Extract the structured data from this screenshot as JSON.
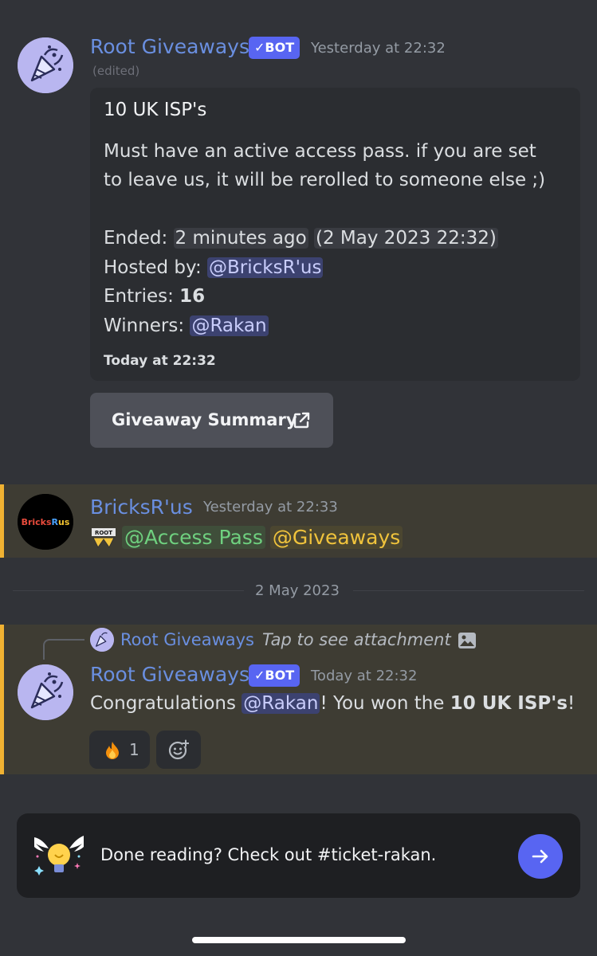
{
  "message1": {
    "author": "Root Giveaways",
    "bot_tag": "BOT",
    "timestamp": "Yesterday at 22:32",
    "edited": "(edited)",
    "embed": {
      "title": "10 UK ISP's",
      "desc_line1": "Must have an active access pass. if you are set",
      "desc_line2": "to leave us, it will be rerolled to someone else ;)",
      "ended_label": "Ended: ",
      "ended_relative": "2 minutes ago",
      "ended_absolute": "(2 May 2023 22:32)",
      "hosted_label": "Hosted by: ",
      "hosted_mention": "@BricksR'us",
      "entries_label": "Entries: ",
      "entries_value": "16",
      "winners_label": "Winners: ",
      "winners_mention": "@Rakan",
      "footer": "Today at 22:32"
    },
    "button_label": "Giveaway Summary"
  },
  "message2": {
    "author": "BricksR'us",
    "timestamp": "Yesterday at 22:33",
    "role1": "@Access Pass",
    "role2": "@Giveaways",
    "avatar_text": "Bricks R us"
  },
  "divider": {
    "date": "2 May 2023"
  },
  "message3": {
    "reply_author": "Root Giveaways",
    "reply_text": "Tap to see attachment",
    "author": "Root Giveaways",
    "bot_tag": "BOT",
    "timestamp": "Today at 22:32",
    "text_prefix": "Congratulations ",
    "mention": "@Rakan",
    "text_mid": "! You won the ",
    "prize": "10 UK ISP's",
    "text_suffix": "!",
    "reaction_count": "1",
    "reaction_icon": "fire-emoji"
  },
  "banner": {
    "text": "Done reading? Check out #ticket-rakan."
  },
  "colors": {
    "background": "#313338",
    "username": "#6a8fe0",
    "bot_tag": "#5865f2",
    "highlight_bar": "#f0b232",
    "mention_bg": "#3c4270"
  }
}
